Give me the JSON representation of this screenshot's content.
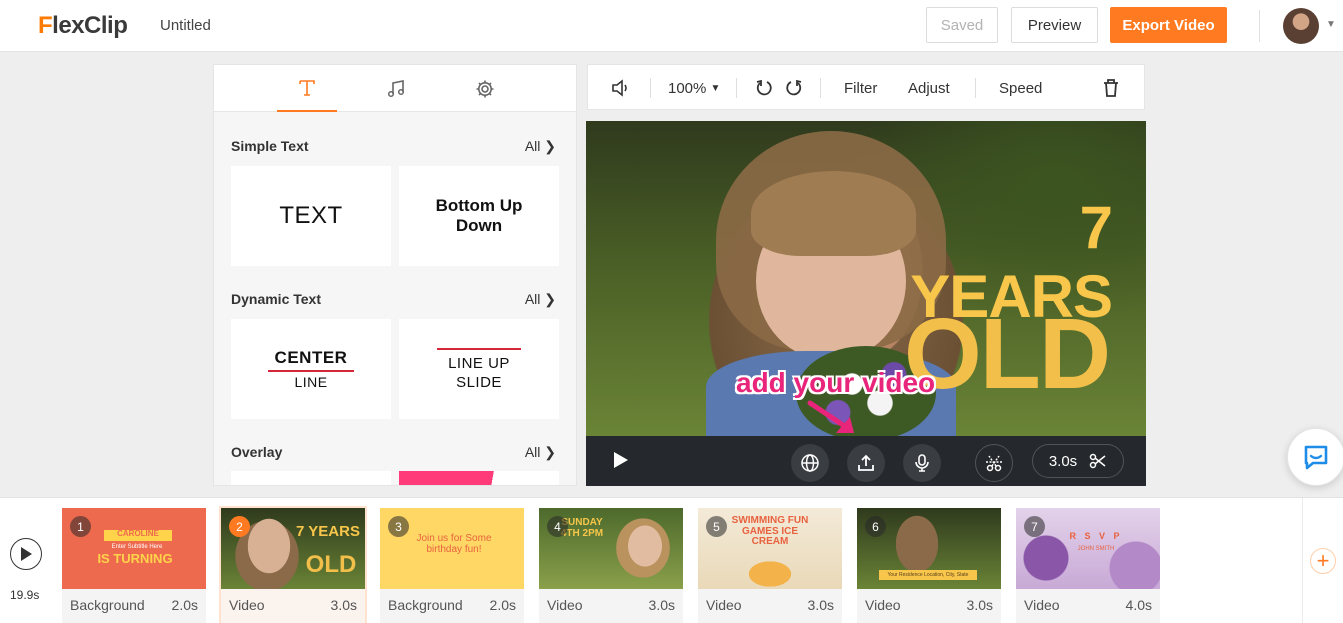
{
  "header": {
    "logo_prefix": "F",
    "logo_rest": "lexClip",
    "doc_title": "Untitled",
    "saved_label": "Saved",
    "preview_label": "Preview",
    "export_label": "Export Video"
  },
  "left_panel": {
    "tabs": [
      {
        "icon": "text-icon",
        "glyph": "T",
        "active": true
      },
      {
        "icon": "music-icon",
        "glyph": "♫",
        "active": false
      },
      {
        "icon": "gear-icon",
        "glyph": "⚙",
        "active": false
      }
    ],
    "sections": {
      "simple": {
        "title": "Simple Text",
        "all": "All"
      },
      "dynamic": {
        "title": "Dynamic Text",
        "all": "All"
      },
      "overlay": {
        "title": "Overlay",
        "all": "All"
      }
    },
    "cards": {
      "text": "TEXT",
      "bottom_up": "Bottom Up Down",
      "center_top": "CENTER",
      "center_bottom": "LINE",
      "lineup_1": "LINE UP",
      "lineup_2": "SLIDE"
    }
  },
  "toolbar": {
    "zoom": "100%",
    "filter": "Filter",
    "adjust": "Adjust",
    "speed": "Speed"
  },
  "preview": {
    "title_line1": "7 YEARS",
    "title_line2": "OLD",
    "hint": "add your video",
    "duration": "3.0s"
  },
  "timeline": {
    "total": "19.9s",
    "scenes": [
      {
        "num": "1",
        "type": "Background",
        "duration": "2.0s",
        "active": false,
        "thumb_text": "IS TURNING",
        "thumb_sub": "Enter Subtitle Here",
        "thumb_top": "CAROLINE"
      },
      {
        "num": "2",
        "type": "Video",
        "duration": "3.0s",
        "active": true,
        "thumb_text": "7 YEARS",
        "thumb_sub": "OLD"
      },
      {
        "num": "3",
        "type": "Background",
        "duration": "2.0s",
        "active": false,
        "thumb_text": "Join us for Some birthday fun!"
      },
      {
        "num": "4",
        "type": "Video",
        "duration": "3.0s",
        "active": false,
        "thumb_text": "SUNDAY 4TH 2PM"
      },
      {
        "num": "5",
        "type": "Video",
        "duration": "3.0s",
        "active": false,
        "thumb_text": "SWIMMING FUN GAMES ICE CREAM"
      },
      {
        "num": "6",
        "type": "Video",
        "duration": "3.0s",
        "active": false,
        "thumb_text": "Your Residence Location, City, State"
      },
      {
        "num": "7",
        "type": "Video",
        "duration": "4.0s",
        "active": false,
        "thumb_text": "R S V P",
        "thumb_sub": "JOHN SMITH"
      }
    ]
  },
  "colors": {
    "brand_orange": "#ff7a20",
    "title_yellow": "#f7c64a",
    "hint_pink": "#e8257a",
    "chat_blue": "#1f8ce8"
  }
}
